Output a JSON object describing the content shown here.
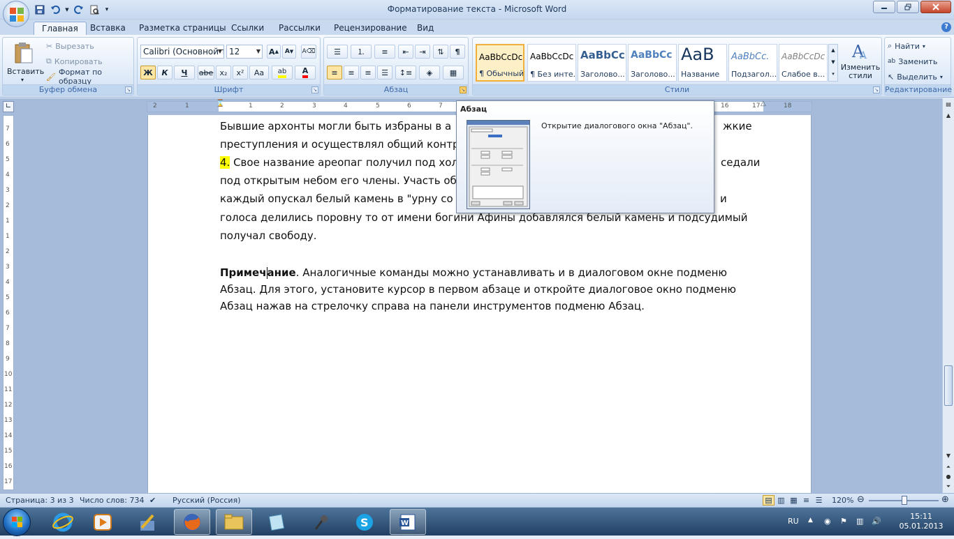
{
  "window": {
    "title": "Форматирование текста - Microsoft Word"
  },
  "ribbon_tabs": [
    "Главная",
    "Вставка",
    "Разметка страницы",
    "Ссылки",
    "Рассылки",
    "Рецензирование",
    "Вид"
  ],
  "clipboard": {
    "paste": "Вставить",
    "cut": "Вырезать",
    "copy": "Копировать",
    "format_painter": "Формат по образцу",
    "label": "Буфер обмена"
  },
  "font": {
    "name": "Calibri (Основной те",
    "size": "12",
    "bold": "Ж",
    "italic": "К",
    "underline": "Ч",
    "strike": "abe",
    "sub": "x₂",
    "sup": "x²",
    "case": "Aa",
    "label": "Шрифт"
  },
  "paragraph": {
    "label": "Абзац"
  },
  "styles": {
    "items": [
      {
        "sample": "AaBbCcDc",
        "name": "¶ Обычный"
      },
      {
        "sample": "AaBbCcDc",
        "name": "¶ Без инте..."
      },
      {
        "sample": "AaBbCc",
        "name": "Заголово..."
      },
      {
        "sample": "AaBbCc",
        "name": "Заголово..."
      },
      {
        "sample": "AaB",
        "name": "Название"
      },
      {
        "sample": "AaBbCc.",
        "name": "Подзагол..."
      },
      {
        "sample": "AaBbCcDc",
        "name": "Слабое в..."
      }
    ],
    "change": "Изменить стили",
    "label": "Стили"
  },
  "editing": {
    "find": "Найти",
    "replace": "Заменить",
    "select": "Выделить",
    "label": "Редактирование"
  },
  "ruler": {
    "h_ticks": [
      "2",
      "1",
      "1",
      "2",
      "3",
      "4",
      "5",
      "6",
      "7",
      "16",
      "17",
      "18"
    ],
    "v_ticks": [
      "7",
      "6",
      "5",
      "4",
      "3",
      "2",
      "1",
      "1",
      "2",
      "3",
      "4",
      "5",
      "6",
      "7",
      "8",
      "9",
      "10",
      "11",
      "12",
      "13",
      "14",
      "15",
      "16",
      "17"
    ]
  },
  "document": {
    "line1": "Бывшие архонты могли быть избраны в а",
    "line1_end": "жкие",
    "line2": "преступления и осуществлял общий контр",
    "line3_num": "4.",
    "line3": " Свое название ареопаг получил под хол",
    "line3_end": "седали",
    "line4": "под открытым небом его члены. Участь об",
    "line5": "каждый опускал белый камень в \"урну со",
    "line5_end": "и",
    "line6": "голоса делились поровну то от имени богини Афины добавлялся белый камень и подсудимый",
    "line7": "получал свободу.",
    "note_bold_a": "Примеч",
    "note_bold_b": "ание",
    "note_rest": ". Аналогичные команды можно устанавливать и в диалоговом окне подменю",
    "note2": "Абзац. Для этого, установите курсор в первом абзаце и откройте диалоговое окно подменю",
    "note3": "Абзац нажав на стрелочку справа на панели инструментов подменю Абзац."
  },
  "tooltip": {
    "title": "Абзац",
    "description": "Открытие диалогового окна \"Абзац\"."
  },
  "status": {
    "page": "Страница: 3 из 3",
    "words": "Число слов: 734",
    "language": "Русский (Россия)",
    "zoom": "120%"
  },
  "taskbar": {
    "lang": "RU",
    "time": "15:11",
    "date": "05.01.2013"
  },
  "colors": {
    "highlight": "#ffff00",
    "font_color": "#ff0000",
    "accent": "#3e6aaa"
  }
}
